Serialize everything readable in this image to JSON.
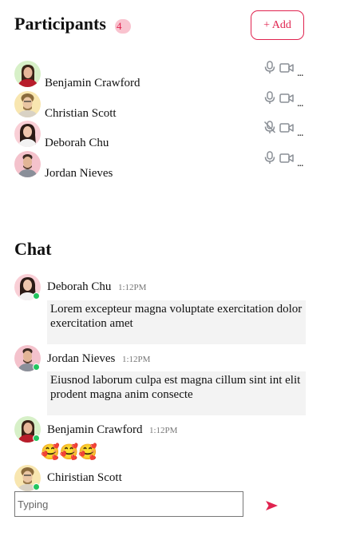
{
  "header": {
    "title": "Participants",
    "count": "4",
    "add_label": "+ Add"
  },
  "participants": [
    {
      "name": "Benjamin Crawford",
      "mic": "on",
      "camera": "on",
      "more": "..."
    },
    {
      "name": "Christian Scott",
      "mic": "on",
      "camera": "on",
      "more": "..."
    },
    {
      "name": "Deborah Chu",
      "mic": "muted",
      "camera": "on",
      "more": "..."
    },
    {
      "name": "Jordan Nieves",
      "mic": "on",
      "camera": "on",
      "more": "..."
    }
  ],
  "chat": {
    "title": "Chat",
    "messages": [
      {
        "name": "Deborah Chu",
        "time": "1:12PM",
        "text": "Lorem excepteur magna voluptate exercitation dolor exercitation amet"
      },
      {
        "name": "Jordan Nieves",
        "time": "1:12PM",
        "text": "Eiusnod laborum culpa est magna cillum sint int elit prodent magna anim consecte"
      },
      {
        "name": "Benjamin Crawford",
        "time": "1:12PM",
        "text": "🥰🥰🥰"
      },
      {
        "name": "Chiristian Scott"
      }
    ]
  },
  "composer": {
    "placeholder": "Typing"
  },
  "colors": {
    "accent": "#e0234f",
    "badge_bg": "#f9c3cf",
    "online": "#22c55e",
    "bubble_bg": "#f3f3f3",
    "icon": "#8a8f96"
  },
  "icons": {
    "mic": "microphone-icon",
    "mic_muted": "microphone-off-icon",
    "camera": "video-camera-icon",
    "send": "send-icon"
  }
}
